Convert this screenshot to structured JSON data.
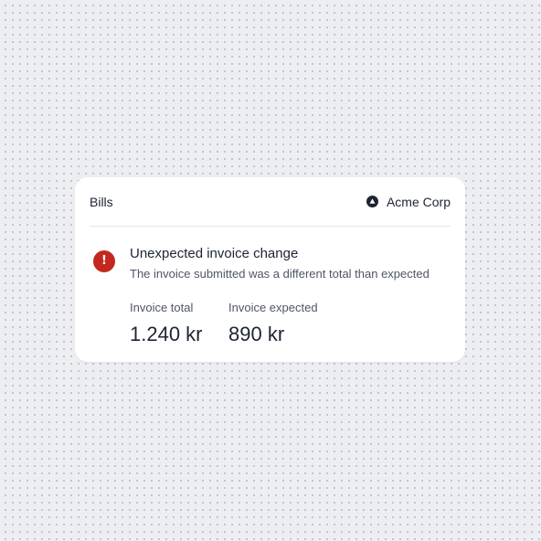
{
  "card": {
    "header": {
      "title": "Bills",
      "organization": {
        "icon": "triangle-circle-icon",
        "name": "Acme Corp"
      }
    },
    "alert": {
      "icon": "exclamation-icon",
      "icon_glyph": "!",
      "icon_color": "#c4271f",
      "title": "Unexpected invoice change",
      "description": "The invoice submitted was a different total than expected"
    },
    "metrics": [
      {
        "label": "Invoice total",
        "value": "1.240 kr"
      },
      {
        "label": "Invoice expected",
        "value": "890 kr"
      }
    ]
  }
}
